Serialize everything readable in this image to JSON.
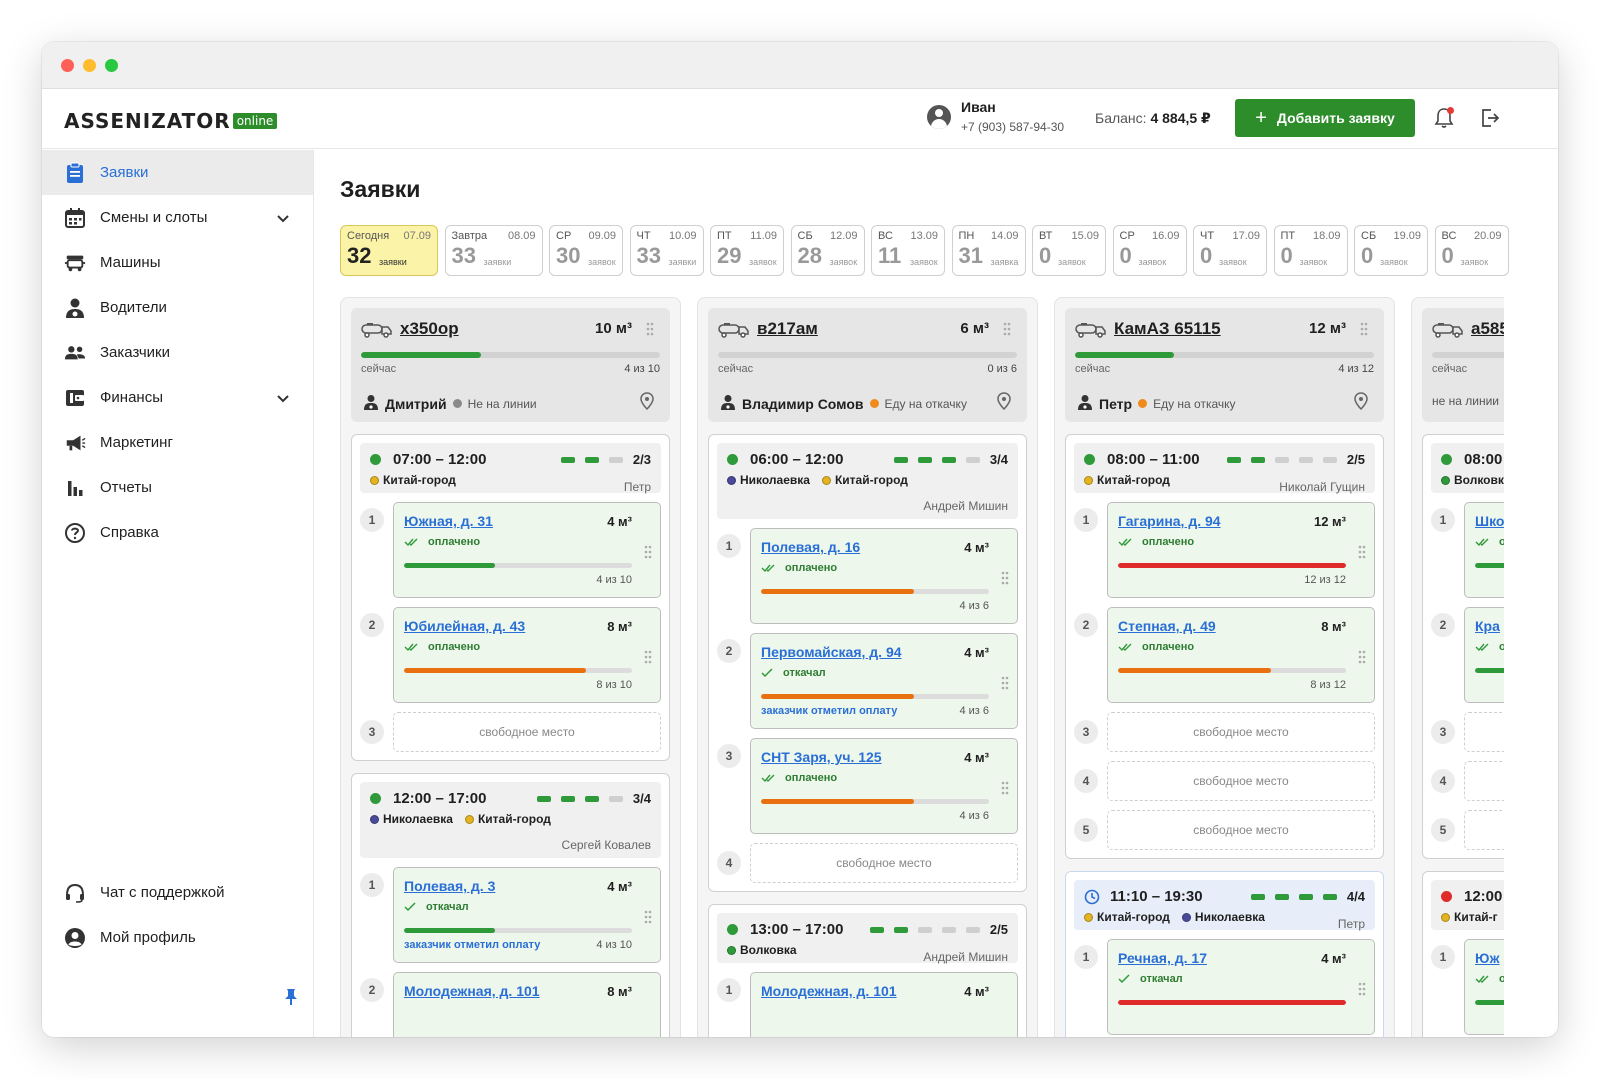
{
  "header": {
    "logo_text": "ASSENIZATOR",
    "logo_badge": "online",
    "user_name": "Иван",
    "user_phone": "+7 (903) 587-94-30",
    "balance_label": "Баланс:",
    "balance_value": "4 884,5 ₽",
    "add_button": "Добавить заявку"
  },
  "sidebar": {
    "items": [
      {
        "label": "Заявки",
        "icon": "clipboard-icon",
        "active": true
      },
      {
        "label": "Смены и слоты",
        "icon": "calendar-icon"
      },
      {
        "label": "Машины",
        "icon": "truck-icon"
      },
      {
        "label": "Водители",
        "icon": "driver-icon"
      },
      {
        "label": "Заказчики",
        "icon": "people-icon"
      },
      {
        "label": "Финансы",
        "icon": "wallet-icon"
      },
      {
        "label": "Маркетинг",
        "icon": "megaphone-icon"
      },
      {
        "label": "Отчеты",
        "icon": "bar-chart-icon"
      },
      {
        "label": "Справка",
        "icon": "help-icon"
      }
    ],
    "bottom": [
      {
        "label": "Чат с поддержкой",
        "icon": "headset-icon"
      },
      {
        "label": "Мой профиль",
        "icon": "profile-icon"
      }
    ]
  },
  "page_title": "Заявки",
  "days": [
    {
      "name": "Сегодня",
      "date": "07.09",
      "count": "32",
      "label": "заявки"
    },
    {
      "name": "Завтра",
      "date": "08.09",
      "count": "33",
      "label": "заявки"
    },
    {
      "name": "СР",
      "date": "09.09",
      "count": "30",
      "label": "заявок"
    },
    {
      "name": "ЧТ",
      "date": "10.09",
      "count": "33",
      "label": "заявки"
    },
    {
      "name": "ПТ",
      "date": "11.09",
      "count": "29",
      "label": "заявок"
    },
    {
      "name": "СБ",
      "date": "12.09",
      "count": "28",
      "label": "заявок"
    },
    {
      "name": "ВС",
      "date": "13.09",
      "count": "11",
      "label": "заявок"
    },
    {
      "name": "ПН",
      "date": "14.09",
      "count": "31",
      "label": "заявка"
    },
    {
      "name": "ВТ",
      "date": "15.09",
      "count": "0",
      "label": "заявок"
    },
    {
      "name": "СР",
      "date": "16.09",
      "count": "0",
      "label": "заявок"
    },
    {
      "name": "ЧТ",
      "date": "17.09",
      "count": "0",
      "label": "заявок"
    },
    {
      "name": "ПТ",
      "date": "18.09",
      "count": "0",
      "label": "заявок"
    },
    {
      "name": "СБ",
      "date": "19.09",
      "count": "0",
      "label": "заявок"
    },
    {
      "name": "ВС",
      "date": "20.09",
      "count": "0",
      "label": "заявок"
    }
  ],
  "colors": {
    "accent_green": "#2c8d2a",
    "progress_green": "#2e9a3a",
    "progress_orange": "#e8700f",
    "progress_red": "#e02b2b",
    "link_blue": "#2a6fd6",
    "today_yellow": "#fbf3a8",
    "status_gray": "#8a8a8a",
    "status_orange": "#f18a1c"
  },
  "labels": {
    "now": "сейчас",
    "free_slot": "свободное место"
  },
  "columns": [
    {
      "plate": "х350ор",
      "volume": "10 м³",
      "load": 0.4,
      "fill": "4 из 10",
      "driver": "Дмитрий",
      "status": "Не на линии",
      "status_color": "#8a8a8a",
      "slots": [
        {
          "time": "07:00 – 12:00",
          "dot": "#2e9a3a",
          "segments": 3,
          "filled": 2,
          "count": "2/3",
          "districts": [
            {
              "name": "Китай-город",
              "color": "#e4b320"
            }
          ],
          "operator": "Петр",
          "operator_low": false,
          "orders": [
            {
              "addr": "Южная, д. 31",
              "vol": "4 м³",
              "status": "оплачено",
              "progress": 0.4,
              "bar": "#2e9a3a",
              "fill": "4 из 10",
              "note": ""
            },
            {
              "addr": "Юбилейная, д. 43",
              "vol": "8 м³",
              "status": "оплачено",
              "progress": 0.8,
              "bar": "#e8700f",
              "fill": "8 из 10",
              "note": ""
            },
            {
              "free": true
            }
          ]
        },
        {
          "time": "12:00 – 17:00",
          "dot": "#2e9a3a",
          "segments": 4,
          "filled": 3,
          "count": "3/4",
          "districts": [
            {
              "name": "Николаевка",
              "color": "#4a4a9a"
            },
            {
              "name": "Китай-город",
              "color": "#e4b320"
            }
          ],
          "operator": "Сергей Ковалев",
          "operator_low": true,
          "orders": [
            {
              "addr": "Полевая, д. 3",
              "vol": "4 м³",
              "status": "откачал",
              "progress": 0.4,
              "bar": "#2e9a3a",
              "fill": "4 из 10",
              "note": "заказчик отметил оплату"
            },
            {
              "addr": "Молодежная, д. 101",
              "vol": "8 м³",
              "status": "",
              "progress": 0,
              "bar": "#2e9a3a",
              "fill": "",
              "note": ""
            }
          ]
        }
      ]
    },
    {
      "plate": "в217ам",
      "volume": "6 м³",
      "load": 0,
      "fill": "0 из 6",
      "driver": "Владимир Сомов",
      "status": "Еду на откачку",
      "status_color": "#f18a1c",
      "slots": [
        {
          "time": "06:00 – 12:00",
          "dot": "#2e9a3a",
          "segments": 4,
          "filled": 3,
          "count": "3/4",
          "districts": [
            {
              "name": "Николаевка",
              "color": "#4a4a9a"
            },
            {
              "name": "Китай-город",
              "color": "#e4b320"
            }
          ],
          "operator": "Андрей Мишин",
          "operator_low": true,
          "orders": [
            {
              "addr": "Полевая, д. 16",
              "vol": "4 м³",
              "status": "оплачено",
              "progress": 0.67,
              "bar": "#e8700f",
              "fill": "4 из 6",
              "note": ""
            },
            {
              "addr": "Первомайская, д. 94",
              "vol": "4 м³",
              "status": "откачал",
              "progress": 0.67,
              "bar": "#e8700f",
              "fill": "4 из 6",
              "note": "заказчик отметил оплату"
            },
            {
              "addr": "СНТ Заря, уч. 125",
              "vol": "4 м³",
              "status": "оплачено",
              "progress": 0.67,
              "bar": "#e8700f",
              "fill": "4 из 6",
              "note": ""
            },
            {
              "free": true
            }
          ]
        },
        {
          "time": "13:00 – 17:00",
          "dot": "#2e9a3a",
          "segments": 5,
          "filled": 2,
          "count": "2/5",
          "districts": [
            {
              "name": "Волковка",
              "color": "#2e9a3a"
            }
          ],
          "operator": "Андрей Мишин",
          "operator_low": false,
          "orders": [
            {
              "addr": "Молодежная, д. 101",
              "vol": "4 м³",
              "status": "",
              "progress": 0,
              "bar": "#2e9a3a",
              "fill": "",
              "note": ""
            }
          ]
        }
      ]
    },
    {
      "plate": "КамАЗ 65115",
      "volume": "12 м³",
      "load": 0.33,
      "fill": "4 из 12",
      "driver": "Петр",
      "status": "Еду на откачку",
      "status_color": "#f18a1c",
      "slots": [
        {
          "time": "08:00 – 11:00",
          "dot": "#2e9a3a",
          "segments": 5,
          "filled": 2,
          "count": "2/5",
          "districts": [
            {
              "name": "Китай-город",
              "color": "#e4b320"
            }
          ],
          "operator": "Николай Гущин",
          "operator_low": false,
          "orders": [
            {
              "addr": "Гагарина, д. 94",
              "vol": "12 м³",
              "status": "оплачено",
              "progress": 1,
              "bar": "#e02b2b",
              "fill": "12 из 12",
              "note": ""
            },
            {
              "addr": "Степная, д. 49",
              "vol": "8 м³",
              "status": "оплачено",
              "progress": 0.67,
              "bar": "#e8700f",
              "fill": "8 из 12",
              "note": ""
            },
            {
              "free": true
            },
            {
              "free": true
            },
            {
              "free": true
            }
          ]
        },
        {
          "time": "11:10 – 19:30",
          "dot": "clock",
          "segments": 4,
          "filled": 4,
          "count": "4/4",
          "alt": true,
          "districts": [
            {
              "name": "Китай-город",
              "color": "#e4b320"
            },
            {
              "name": "Николаевка",
              "color": "#4a4a9a"
            }
          ],
          "operator": "Петр",
          "operator_low": false,
          "orders": [
            {
              "addr": "Речная, д. 17",
              "vol": "4 м³",
              "status": "откачал",
              "progress": 1,
              "bar": "#e02b2b",
              "fill": "",
              "note": ""
            }
          ]
        }
      ]
    },
    {
      "plate": "а585",
      "volume": "",
      "load": 0,
      "fill": "",
      "driver": "",
      "status": "не на линии",
      "status_color": "",
      "slots": [
        {
          "time": "08:00",
          "dot": "#2e9a3a",
          "segments": 0,
          "filled": 0,
          "count": "",
          "districts": [
            {
              "name": "Волковк",
              "color": "#2e9a3a"
            }
          ],
          "operator": "",
          "operator_low": false,
          "orders": [
            {
              "addr": "Шко",
              "vol": "",
              "status": "о",
              "progress": 0.5,
              "bar": "#2e9a3a",
              "fill": "",
              "note": ""
            },
            {
              "addr": "Кра",
              "vol": "",
              "status": "о",
              "progress": 0.5,
              "bar": "#2e9a3a",
              "fill": "",
              "note": ""
            },
            {
              "free": true
            },
            {
              "free": true
            },
            {
              "free": true
            }
          ]
        },
        {
          "time": "12:00",
          "dot": "#e02b2b",
          "segments": 0,
          "filled": 0,
          "count": "",
          "districts": [
            {
              "name": "Китай-г",
              "color": "#e4b320"
            }
          ],
          "operator": "",
          "operator_low": false,
          "orders": [
            {
              "addr": "Юж",
              "vol": "",
              "status": "о",
              "progress": 0.5,
              "bar": "#2e9a3a",
              "fill": "",
              "note": ""
            }
          ]
        }
      ]
    }
  ]
}
